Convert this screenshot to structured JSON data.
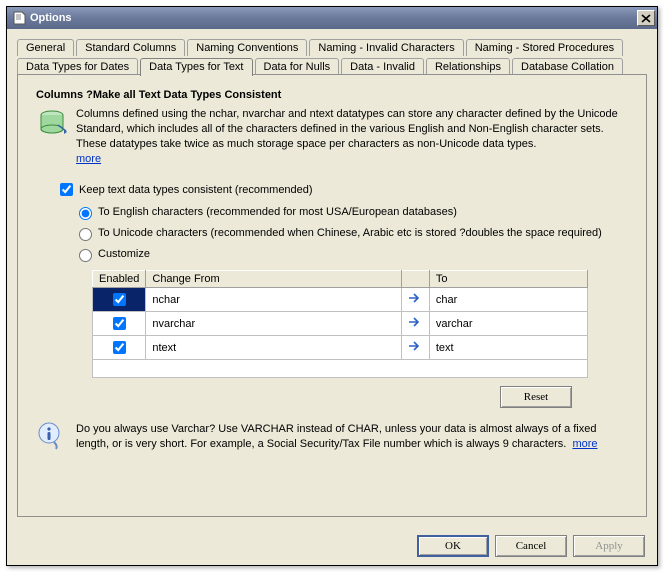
{
  "title": "Options",
  "tabs_row1": [
    "General",
    "Standard Columns",
    "Naming Conventions",
    "Naming - Invalid Characters",
    "Naming - Stored Procedures"
  ],
  "tabs_row2": [
    "Data Types for Dates",
    "Data Types for Text",
    "Data for Nulls",
    "Data - Invalid",
    "Relationships",
    "Database Collation"
  ],
  "active_tab": "Data Types for Text",
  "heading": "Columns ?Make all Text Data Types Consistent",
  "description": "Columns defined using the nchar, nvarchar and ntext datatypes can store any character defined by the Unicode Standard, which includes all of the characters defined in the various English and Non-English character sets. These datatypes take twice as much storage space per characters as non-Unicode data types.",
  "more_link": "more",
  "keep_consistent": {
    "label": "Keep text data types consistent (recommended)",
    "checked": true
  },
  "radios": {
    "english": {
      "label": "To English characters (recommended for most USA/European databases)",
      "checked": true
    },
    "unicode": {
      "label": "To Unicode characters (recommended when Chinese, Arabic etc is stored ?doubles the space required)",
      "checked": false
    },
    "customize": {
      "label": "Customize",
      "checked": false
    }
  },
  "table": {
    "headers": {
      "enabled": "Enabled",
      "from": "Change From",
      "arrow": "",
      "to": "To"
    },
    "rows": [
      {
        "enabled": true,
        "from": "nchar",
        "to": "char",
        "selected": true
      },
      {
        "enabled": true,
        "from": "nvarchar",
        "to": "varchar",
        "selected": false
      },
      {
        "enabled": true,
        "from": "ntext",
        "to": "text",
        "selected": false
      }
    ]
  },
  "reset_label": "Reset",
  "tip_text": "Do you always use Varchar? Use VARCHAR instead of CHAR, unless your data is almost always of a fixed length, or is very short. For example, a Social Security/Tax File number which is always 9 characters.",
  "tip_more": "more",
  "buttons": {
    "ok": "OK",
    "cancel": "Cancel",
    "apply": "Apply"
  }
}
